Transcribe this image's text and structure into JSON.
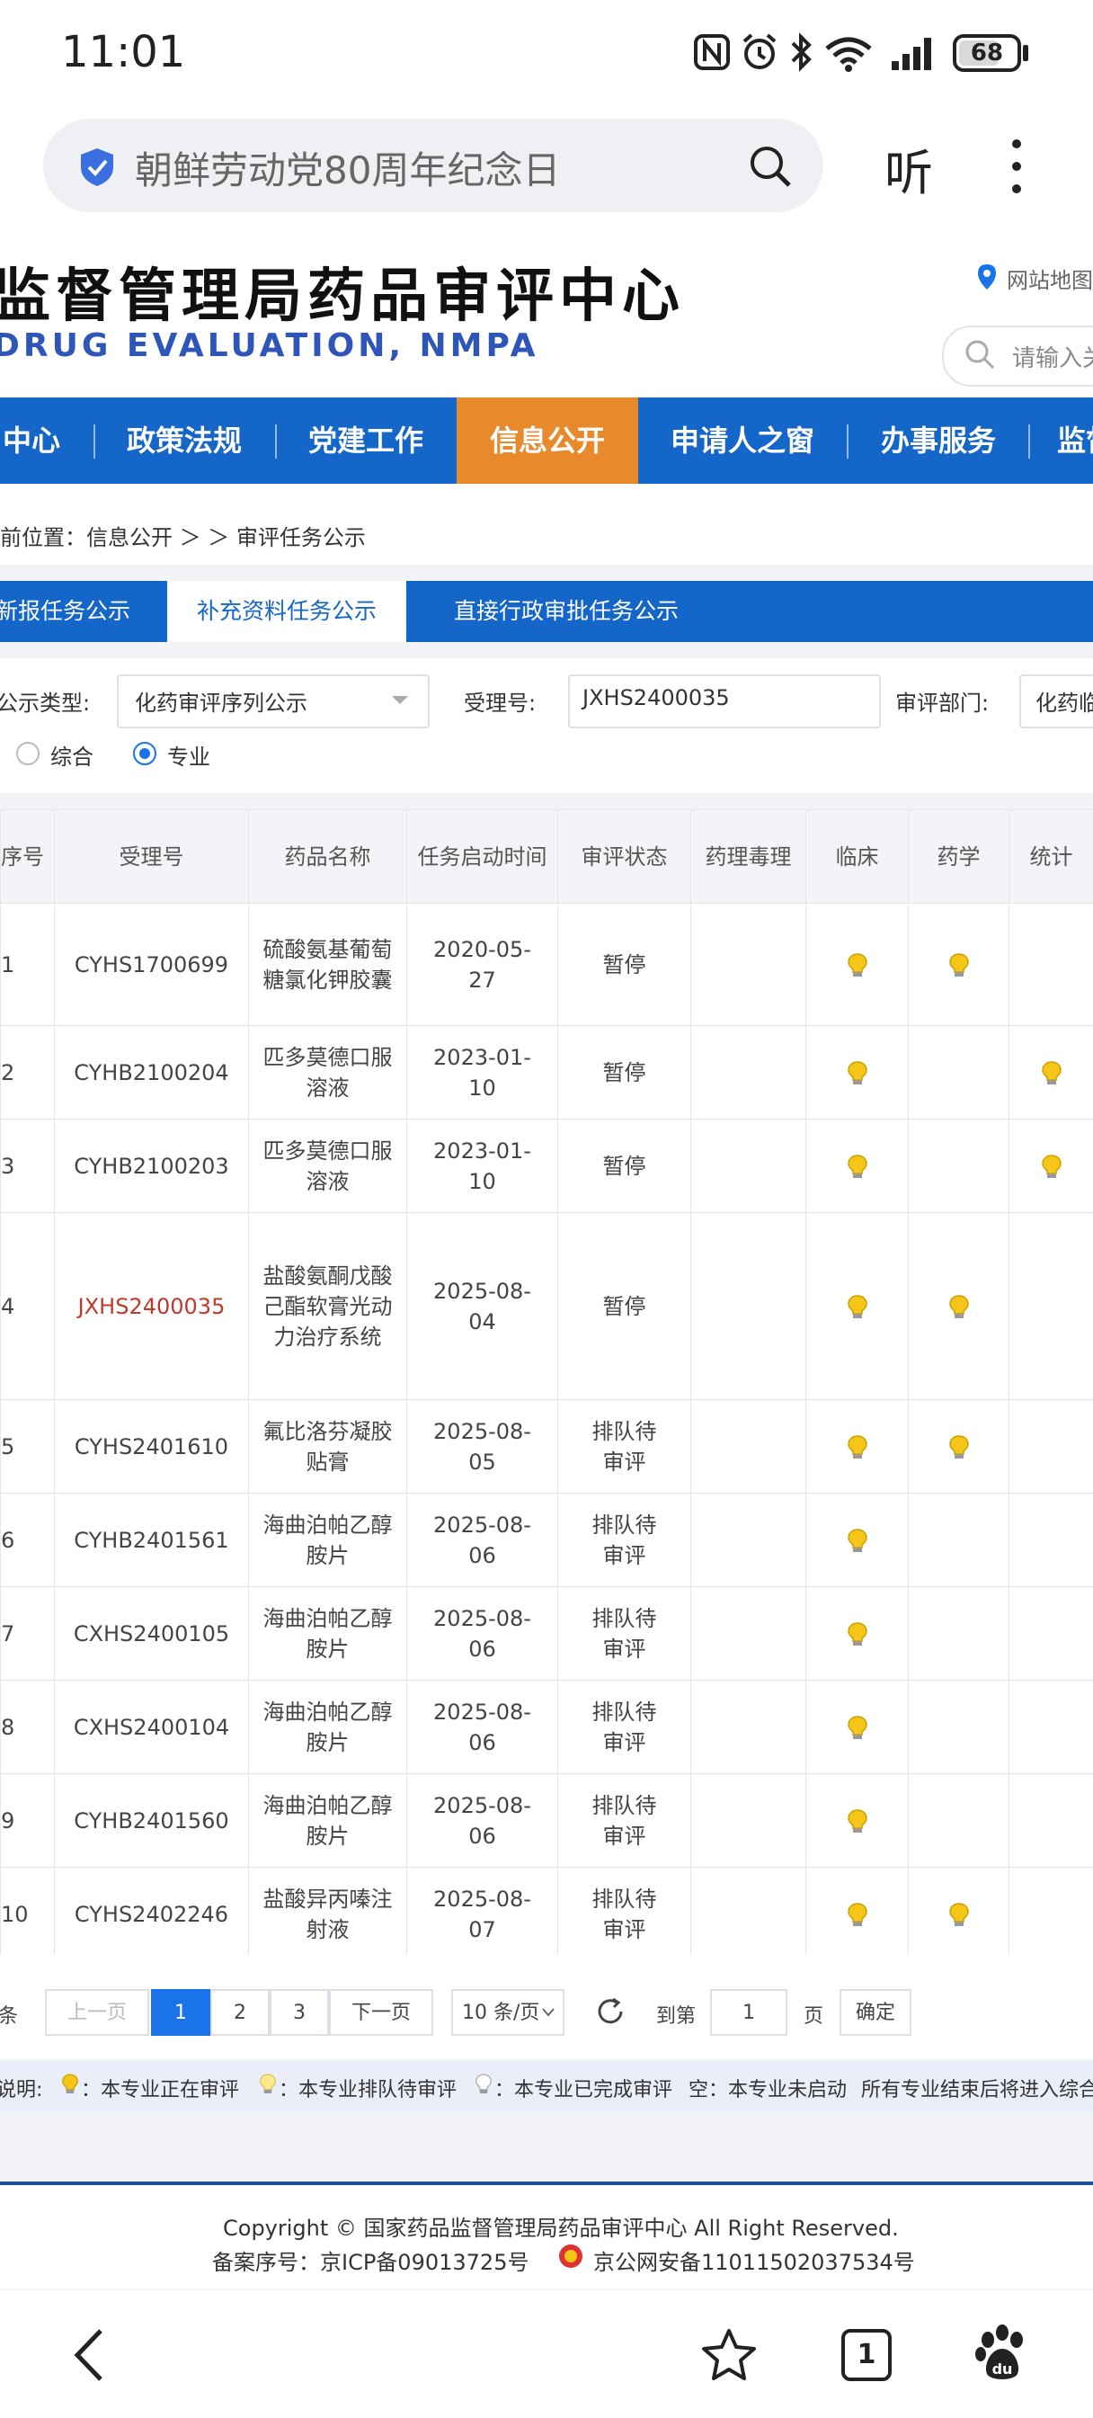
{
  "status_bar": {
    "time": "11:01",
    "battery": "68"
  },
  "browser": {
    "address_text": "朝鲜劳动党80周年纪念日",
    "listen_label": "听"
  },
  "site": {
    "title": "监督管理局药品审评中心",
    "subtitle": "DRUG EVALUATION, NMPA",
    "sitemap_label": "网站地图",
    "search_placeholder": "请输入关"
  },
  "nav": {
    "items": [
      "中心",
      "政策法规",
      "党建工作",
      "信息公开",
      "申请人之窗",
      "办事服务",
      "监督"
    ],
    "active": "信息公开"
  },
  "breadcrumb": "前位置：信息公开 ＞ ＞ 审评任务公示",
  "tabs": [
    "新报任务公示",
    "补充资料任务公示",
    "直接行政审批任务公示"
  ],
  "filters": {
    "type_label": "公示类型:",
    "type_value": "化药审评序列公示",
    "accept_label": "受理号:",
    "accept_value": "JXHS2400035",
    "dept_label": "审评部门:",
    "dept_value": "化药临",
    "radio_comprehensive": "综合",
    "radio_professional": "专业",
    "selected_radio": "专业"
  },
  "table": {
    "headers": [
      "序号",
      "受理号",
      "药品名称",
      "任务启动时间",
      "审评状态",
      "药理毒理",
      "临床",
      "药学",
      "统计"
    ],
    "rows": [
      {
        "index": "1",
        "accept_no": "CYHS1700699",
        "drug_name": "硫酸氨基葡萄糖氯化钾胶囊",
        "start_date": "2020-05-27",
        "status": "暂停",
        "clinical": "in-review",
        "pharmacy": "in-review",
        "stats": ""
      },
      {
        "index": "2",
        "accept_no": "CYHB2100204",
        "drug_name": "匹多莫德口服溶液",
        "start_date": "2023-01-10",
        "status": "暂停",
        "clinical": "in-review",
        "pharmacy": "",
        "stats": "in-review"
      },
      {
        "index": "3",
        "accept_no": "CYHB2100203",
        "drug_name": "匹多莫德口服溶液",
        "start_date": "2023-01-10",
        "status": "暂停",
        "clinical": "in-review",
        "pharmacy": "",
        "stats": "in-review"
      },
      {
        "index": "4",
        "accept_no": "JXHS2400035",
        "drug_name": "盐酸氨酮戊酸己酯软膏光动力治疗系统",
        "start_date": "2025-08-04",
        "status": "暂停",
        "clinical": "in-review",
        "pharmacy": "in-review",
        "stats": "",
        "highlight": true
      },
      {
        "index": "5",
        "accept_no": "CYHS2401610",
        "drug_name": "氟比洛芬凝胶贴膏",
        "start_date": "2025-08-05",
        "status": "排队待审评",
        "clinical": "in-review",
        "pharmacy": "in-review",
        "stats": ""
      },
      {
        "index": "6",
        "accept_no": "CYHB2401561",
        "drug_name": "海曲泊帕乙醇胺片",
        "start_date": "2025-08-06",
        "status": "排队待审评",
        "clinical": "in-review",
        "pharmacy": "",
        "stats": ""
      },
      {
        "index": "7",
        "accept_no": "CXHS2400105",
        "drug_name": "海曲泊帕乙醇胺片",
        "start_date": "2025-08-06",
        "status": "排队待审评",
        "clinical": "in-review",
        "pharmacy": "",
        "stats": ""
      },
      {
        "index": "8",
        "accept_no": "CXHS2400104",
        "drug_name": "海曲泊帕乙醇胺片",
        "start_date": "2025-08-06",
        "status": "排队待审评",
        "clinical": "in-review",
        "pharmacy": "",
        "stats": ""
      },
      {
        "index": "9",
        "accept_no": "CYHB2401560",
        "drug_name": "海曲泊帕乙醇胺片",
        "start_date": "2025-08-06",
        "status": "排队待审评",
        "clinical": "in-review",
        "pharmacy": "",
        "stats": ""
      },
      {
        "index": "10",
        "accept_no": "CYHS2402246",
        "drug_name": "盐酸异丙嗪注射液",
        "start_date": "2025-08-07",
        "status": "排队待审评",
        "clinical": "in-review",
        "pharmacy": "in-review",
        "stats": ""
      }
    ]
  },
  "pager": {
    "total_suffix": "条",
    "prev_label": "上一页",
    "pages": [
      "1",
      "2",
      "3"
    ],
    "current_page": "1",
    "next_label": "下一页",
    "page_size": "10 条/页",
    "goto_label": "到第",
    "goto_value": "1",
    "page_unit": "页",
    "confirm_label": "确定"
  },
  "legend": {
    "prefix": "说明:",
    "in_review": "：本专业正在审评",
    "queued": "：本专业排队待审评",
    "done": "：本专业已完成审评",
    "not_started": "空：本专业未启动",
    "final": "所有专业结束后将进入综合审"
  },
  "footer": {
    "copyright": "Copyright © 国家药品监督管理局药品审评中心   All Right Reserved.",
    "icp": "备案序号：京ICP备09013725号",
    "police": "京公网安备11011502037534号"
  },
  "colors": {
    "nav_blue": "#1566c9",
    "nav_active": "#e8892c",
    "title_blue": "#2e56b8",
    "highlight_red": "#c0392b",
    "bulb_yellow": "#f5c518"
  }
}
